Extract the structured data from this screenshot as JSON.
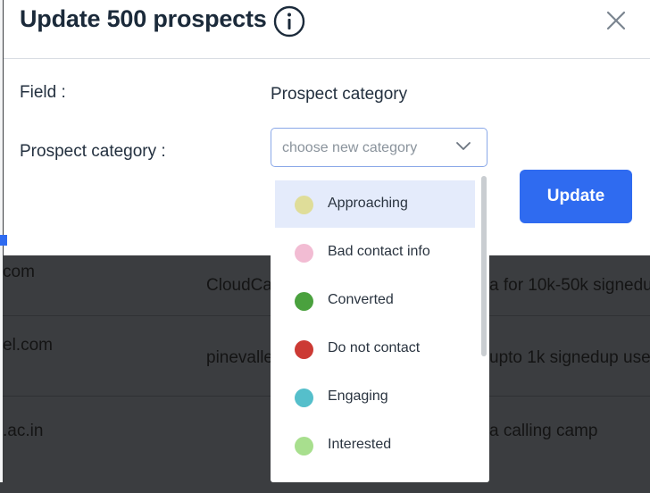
{
  "modal": {
    "title": "Update 500 prospects",
    "field_label": "Field :",
    "field_value": "Prospect category",
    "category_label": "Prospect category :",
    "select_placeholder": "choose new category",
    "update_label": "Update"
  },
  "dropdown": {
    "options": [
      {
        "label": "Approaching",
        "color": "#dfdd99"
      },
      {
        "label": "Bad contact info",
        "color": "#f2bcd3"
      },
      {
        "label": "Converted",
        "color": "#4aa13e"
      },
      {
        "label": "Do not contact",
        "color": "#cc3a34"
      },
      {
        "label": "Engaging",
        "color": "#55bfcb"
      },
      {
        "label": "Interested",
        "color": "#a8df8e"
      }
    ]
  },
  "background_table": {
    "rows": [
      {
        "email": "com",
        "company": "CloudCa",
        "campaign": "a for 10k-50k signedup"
      },
      {
        "email": "el.com",
        "company": "pinevalle",
        "campaign": "upto 1k signedup use"
      },
      {
        "email": ".ac.in",
        "company": "",
        "campaign": "a calling camp"
      }
    ]
  },
  "colors": {
    "accent": "#2f6bf0",
    "overlay": "#3b3d40"
  }
}
